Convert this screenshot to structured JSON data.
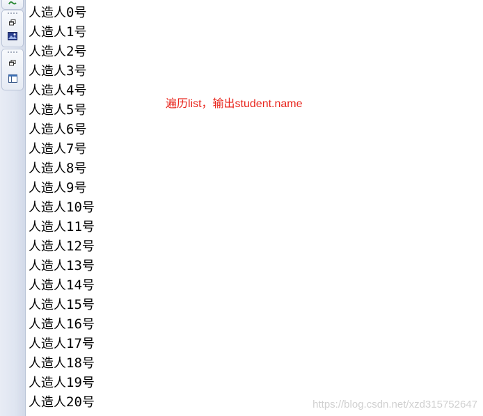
{
  "toolbar": {
    "icons": [
      "refresh-icon",
      "restore-window-icon",
      "image-icon",
      "restore-window-icon",
      "layout-panel-icon"
    ]
  },
  "console": {
    "lines": [
      {
        "prefix": "人造人",
        "num": "0",
        "suffix": "号"
      },
      {
        "prefix": "人造人",
        "num": "1",
        "suffix": "号"
      },
      {
        "prefix": "人造人",
        "num": "2",
        "suffix": "号"
      },
      {
        "prefix": "人造人",
        "num": "3",
        "suffix": "号"
      },
      {
        "prefix": "人造人",
        "num": "4",
        "suffix": "号"
      },
      {
        "prefix": "人造人",
        "num": "5",
        "suffix": "号"
      },
      {
        "prefix": "人造人",
        "num": "6",
        "suffix": "号"
      },
      {
        "prefix": "人造人",
        "num": "7",
        "suffix": "号"
      },
      {
        "prefix": "人造人",
        "num": "8",
        "suffix": "号"
      },
      {
        "prefix": "人造人",
        "num": "9",
        "suffix": "号"
      },
      {
        "prefix": "人造人",
        "num": "10",
        "suffix": "号"
      },
      {
        "prefix": "人造人",
        "num": "11",
        "suffix": "号"
      },
      {
        "prefix": "人造人",
        "num": "12",
        "suffix": "号"
      },
      {
        "prefix": "人造人",
        "num": "13",
        "suffix": "号"
      },
      {
        "prefix": "人造人",
        "num": "14",
        "suffix": "号"
      },
      {
        "prefix": "人造人",
        "num": "15",
        "suffix": "号"
      },
      {
        "prefix": "人造人",
        "num": "16",
        "suffix": "号"
      },
      {
        "prefix": "人造人",
        "num": "17",
        "suffix": "号"
      },
      {
        "prefix": "人造人",
        "num": "18",
        "suffix": "号"
      },
      {
        "prefix": "人造人",
        "num": "19",
        "suffix": "号"
      },
      {
        "prefix": "人造人",
        "num": "20",
        "suffix": "号"
      }
    ]
  },
  "annotation": {
    "text": "遍历list，输出student.name",
    "color": "#e8251c"
  },
  "watermark": {
    "text": "https://blog.csdn.net/xzd315752647"
  }
}
